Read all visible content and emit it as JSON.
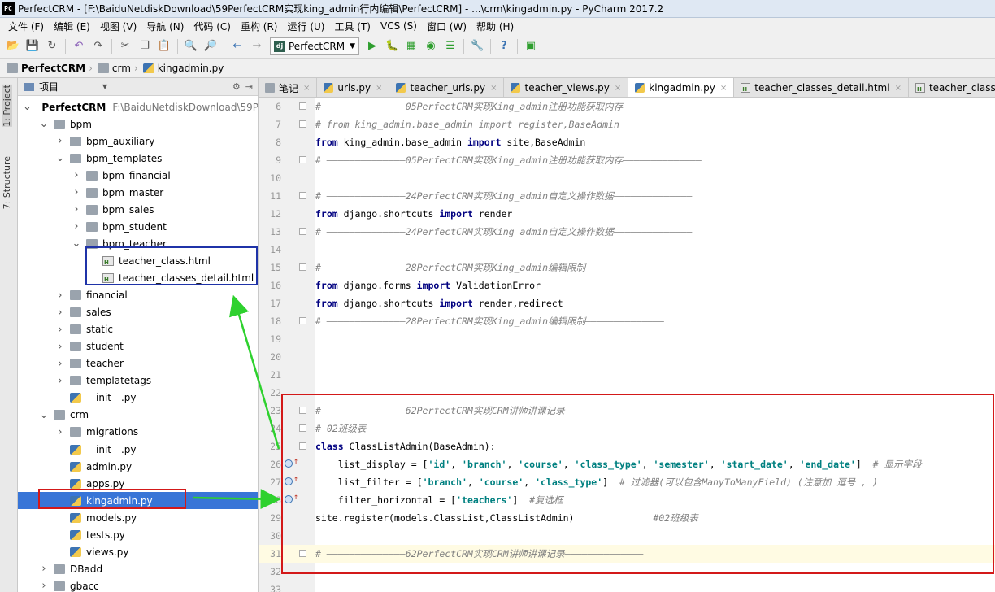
{
  "window": {
    "app_icon_text": "PC",
    "title": "PerfectCRM - [F:\\BaiduNetdiskDownload\\59PerfectCRM实现king_admin行内编辑\\PerfectCRM] - ...\\crm\\kingadmin.py - PyCharm 2017.2"
  },
  "menu": [
    "文件 (F)",
    "编辑 (E)",
    "视图 (V)",
    "导航 (N)",
    "代码 (C)",
    "重构 (R)",
    "运行 (U)",
    "工具 (T)",
    "VCS (S)",
    "窗口 (W)",
    "帮助 (H)"
  ],
  "toolbar": {
    "run_config_label": "PerfectCRM",
    "run_config_icon": "dj"
  },
  "breadcrumb": [
    "PerfectCRM",
    "crm",
    "kingadmin.py"
  ],
  "side_tabs": {
    "project": "1: Project",
    "structure": "7: Structure"
  },
  "project_panel": {
    "header": "项目",
    "tree": [
      {
        "label": "PerfectCRM",
        "path": "F:\\BaiduNetdiskDownload\\59P",
        "type": "folder",
        "expanded": true,
        "bold": true
      },
      {
        "label": "bpm",
        "type": "folder",
        "expanded": true
      },
      {
        "label": "bpm_auxiliary",
        "type": "folder",
        "expanded": false
      },
      {
        "label": "bpm_templates",
        "type": "folder",
        "expanded": true
      },
      {
        "label": "bpm_financial",
        "type": "folder",
        "expanded": false
      },
      {
        "label": "bpm_master",
        "type": "folder",
        "expanded": false
      },
      {
        "label": "bpm_sales",
        "type": "folder",
        "expanded": false
      },
      {
        "label": "bpm_student",
        "type": "folder",
        "expanded": false
      },
      {
        "label": "bpm_teacher",
        "type": "folder",
        "expanded": true
      },
      {
        "label": "teacher_class.html",
        "type": "html"
      },
      {
        "label": "teacher_classes_detail.html",
        "type": "html"
      },
      {
        "label": "financial",
        "type": "folder",
        "expanded": false
      },
      {
        "label": "sales",
        "type": "folder",
        "expanded": false
      },
      {
        "label": "static",
        "type": "folder",
        "expanded": false
      },
      {
        "label": "student",
        "type": "folder",
        "expanded": false
      },
      {
        "label": "teacher",
        "type": "folder",
        "expanded": false
      },
      {
        "label": "templatetags",
        "type": "folder",
        "expanded": false
      },
      {
        "label": "__init__.py",
        "type": "py"
      },
      {
        "label": "crm",
        "type": "folder",
        "expanded": true
      },
      {
        "label": "migrations",
        "type": "folder",
        "expanded": false
      },
      {
        "label": "__init__.py",
        "type": "py"
      },
      {
        "label": "admin.py",
        "type": "py"
      },
      {
        "label": "apps.py",
        "type": "py"
      },
      {
        "label": "kingadmin.py",
        "type": "py",
        "selected": true
      },
      {
        "label": "models.py",
        "type": "py"
      },
      {
        "label": "tests.py",
        "type": "py"
      },
      {
        "label": "views.py",
        "type": "py"
      },
      {
        "label": "DBadd",
        "type": "folder",
        "expanded": false
      },
      {
        "label": "gbacc",
        "type": "folder",
        "expanded": false
      }
    ]
  },
  "editor_tabs": [
    {
      "label": "笔记",
      "icon": "note-icon"
    },
    {
      "label": "urls.py",
      "icon": "python-file-icon"
    },
    {
      "label": "teacher_urls.py",
      "icon": "python-file-icon"
    },
    {
      "label": "teacher_views.py",
      "icon": "python-file-icon"
    },
    {
      "label": "kingadmin.py",
      "icon": "python-file-icon",
      "active": true
    },
    {
      "label": "teacher_classes_detail.html",
      "icon": "html-file-icon"
    },
    {
      "label": "teacher_class.htm",
      "icon": "html-file-icon"
    }
  ],
  "code": [
    {
      "n": "6",
      "text": "# ——————————————05PerfectCRM实现King_admin注册功能获取内存——————————————",
      "kind": "comment"
    },
    {
      "n": "7",
      "text": "# from king_admin.base_admin import register,BaseAdmin",
      "kind": "comment"
    },
    {
      "n": "8",
      "parts": [
        [
          "kw",
          "from"
        ],
        [
          "plain",
          " king_admin.base_admin "
        ],
        [
          "kw",
          "import"
        ],
        [
          "plain",
          " site,BaseAdmin"
        ]
      ]
    },
    {
      "n": "9",
      "text": "# ——————————————05PerfectCRM实现King_admin注册功能获取内存——————————————",
      "kind": "comment"
    },
    {
      "n": "10",
      "text": "",
      "kind": "plain"
    },
    {
      "n": "11",
      "text": "# ——————————————24PerfectCRM实现King_admin自定义操作数据——————————————",
      "kind": "comment"
    },
    {
      "n": "12",
      "parts": [
        [
          "kw",
          "from"
        ],
        [
          "plain",
          " django.shortcuts "
        ],
        [
          "kw",
          "import"
        ],
        [
          "plain",
          " render"
        ]
      ]
    },
    {
      "n": "13",
      "text": "# ——————————————24PerfectCRM实现King_admin自定义操作数据——————————————",
      "kind": "comment"
    },
    {
      "n": "14",
      "text": "",
      "kind": "plain"
    },
    {
      "n": "15",
      "text": "# ——————————————28PerfectCRM实现King_admin编辑限制——————————————",
      "kind": "comment"
    },
    {
      "n": "16",
      "parts": [
        [
          "kw",
          "from"
        ],
        [
          "plain",
          " django.forms "
        ],
        [
          "kw",
          "import"
        ],
        [
          "plain",
          " ValidationError"
        ]
      ]
    },
    {
      "n": "17",
      "parts": [
        [
          "kw",
          "from"
        ],
        [
          "plain",
          " django.shortcuts "
        ],
        [
          "kw",
          "import"
        ],
        [
          "plain",
          " render,redirect"
        ]
      ]
    },
    {
      "n": "18",
      "text": "# ——————————————28PerfectCRM实现King_admin编辑限制——————————————",
      "kind": "comment"
    },
    {
      "n": "19",
      "text": "",
      "kind": "plain"
    },
    {
      "n": "20",
      "text": "",
      "kind": "plain"
    },
    {
      "n": "21",
      "text": "",
      "kind": "plain"
    },
    {
      "n": "22",
      "text": "",
      "kind": "plain"
    },
    {
      "n": "23",
      "text": "# ——————————————62PerfectCRM实现CRM讲师讲课记录——————————————",
      "kind": "comment"
    },
    {
      "n": "24",
      "text": "# 02班级表",
      "kind": "comment"
    },
    {
      "n": "25",
      "parts": [
        [
          "kw",
          "class"
        ],
        [
          "plain",
          " ClassListAdmin(BaseAdmin):"
        ]
      ]
    },
    {
      "n": "26",
      "parts": [
        [
          "plain",
          "    list_display = ["
        ],
        [
          "str",
          "'id'"
        ],
        [
          "plain",
          ", "
        ],
        [
          "str",
          "'branch'"
        ],
        [
          "plain",
          ", "
        ],
        [
          "str",
          "'course'"
        ],
        [
          "plain",
          ", "
        ],
        [
          "str",
          "'class_type'"
        ],
        [
          "plain",
          ", "
        ],
        [
          "str",
          "'semester'"
        ],
        [
          "plain",
          ", "
        ],
        [
          "str",
          "'start_date'"
        ],
        [
          "plain",
          ", "
        ],
        [
          "str",
          "'end_date'"
        ],
        [
          "plain",
          "]  "
        ],
        [
          "cmt",
          "# 显示字段"
        ]
      ]
    },
    {
      "n": "27",
      "parts": [
        [
          "plain",
          "    list_filter = ["
        ],
        [
          "str",
          "'branch'"
        ],
        [
          "plain",
          ", "
        ],
        [
          "str",
          "'course'"
        ],
        [
          "plain",
          ", "
        ],
        [
          "str",
          "'class_type'"
        ],
        [
          "plain",
          "]  "
        ],
        [
          "cmt",
          "# 过滤器(可以包含ManyToManyField) (注意加 逗号 , )"
        ]
      ]
    },
    {
      "n": "28",
      "parts": [
        [
          "plain",
          "    filter_horizontal = ["
        ],
        [
          "str",
          "'teachers'"
        ],
        [
          "plain",
          "]  "
        ],
        [
          "cmt",
          "#复选框"
        ]
      ]
    },
    {
      "n": "29",
      "parts": [
        [
          "plain",
          "site.register(models.ClassList,ClassListAdmin)              "
        ],
        [
          "cmt",
          "#02班级表"
        ]
      ]
    },
    {
      "n": "30",
      "text": "",
      "kind": "plain"
    },
    {
      "n": "31",
      "text": "# ——————————————62PerfectCRM实现CRM讲师讲课记录——————————————",
      "kind": "comment"
    },
    {
      "n": "32",
      "text": "",
      "kind": "plain"
    },
    {
      "n": "33",
      "text": "",
      "kind": "plain"
    }
  ],
  "colors": {
    "annotation_blue": "#1f33a8",
    "annotation_red": "#d31919",
    "annotation_green": "#2ed12e",
    "selection": "#3875d7"
  }
}
